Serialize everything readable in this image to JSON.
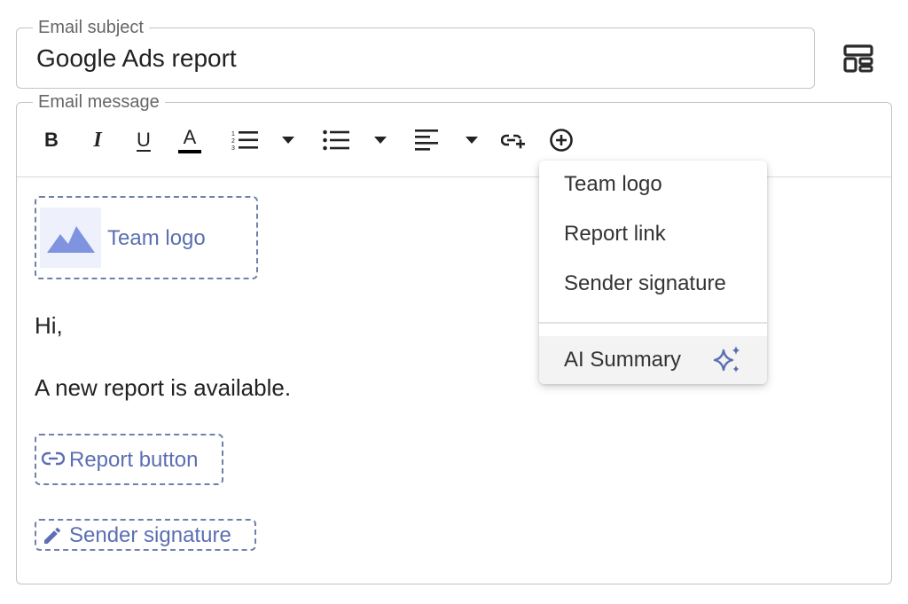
{
  "subject": {
    "legend": "Email subject",
    "value": "Google Ads report"
  },
  "template_icon": "template-layout-icon",
  "message": {
    "legend": "Email message",
    "toolbar": [
      {
        "name": "bold-button",
        "icon": "bold-icon",
        "glyph": "B"
      },
      {
        "name": "italic-button",
        "icon": "italic-icon",
        "glyph": "I"
      },
      {
        "name": "underline-button",
        "icon": "underline-icon",
        "glyph": "U"
      },
      {
        "name": "text-color-button",
        "icon": "text-color-icon",
        "glyph": "A"
      },
      {
        "name": "ordered-list-button",
        "icon": "ordered-list-icon"
      },
      {
        "name": "ordered-list-dropdown",
        "icon": "caret-down-icon"
      },
      {
        "name": "bullet-list-button",
        "icon": "bullet-list-icon"
      },
      {
        "name": "bullet-list-dropdown",
        "icon": "caret-down-icon"
      },
      {
        "name": "align-button",
        "icon": "align-left-icon"
      },
      {
        "name": "align-dropdown",
        "icon": "caret-down-icon"
      },
      {
        "name": "insert-link-button",
        "icon": "add-link-icon"
      },
      {
        "name": "insert-block-button",
        "icon": "add-circle-icon"
      }
    ],
    "blocks": {
      "team_logo": "Team logo",
      "greeting": "Hi,",
      "body": "A new report is available.",
      "report_button": "Report button",
      "sender_signature": "Sender signature"
    }
  },
  "insert_menu": {
    "items": [
      "Team logo",
      "Report link",
      "Sender signature"
    ],
    "ai_item": "AI Summary"
  },
  "colors": {
    "accent": "#5b6fb1",
    "logo_fill": "#7f93e0",
    "border": "#c4c4c4"
  }
}
